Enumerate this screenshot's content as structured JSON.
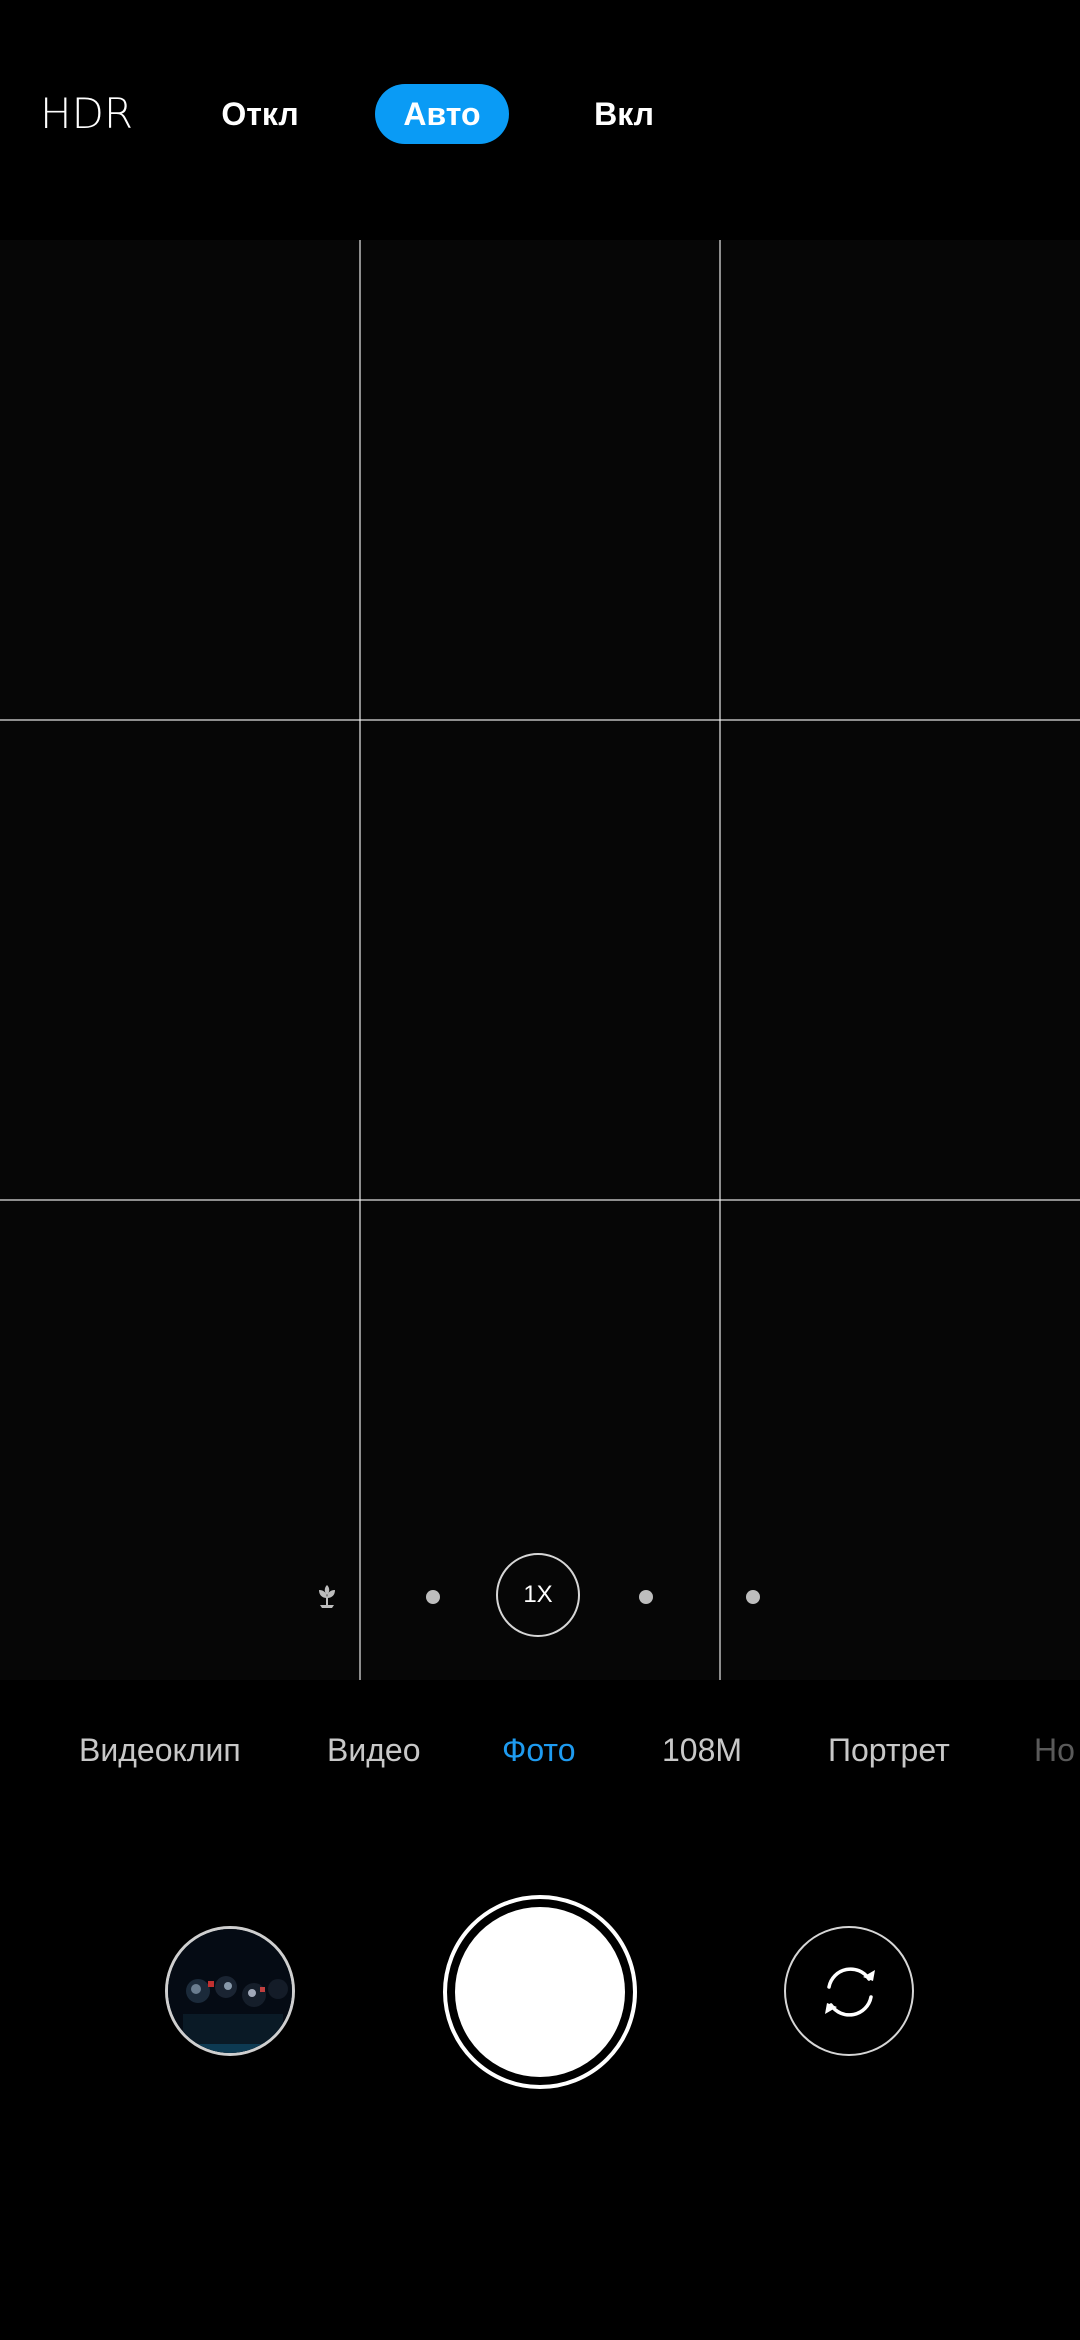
{
  "hdr": {
    "title": "HDR",
    "options": {
      "off": "Откл",
      "auto": "Авто",
      "on": "Вкл"
    },
    "selected": "auto",
    "accent_color": "#0a9bf5"
  },
  "viewfinder": {
    "grid": "3x3",
    "zoom": {
      "current": "1X",
      "icons": [
        "macro-flower-icon"
      ]
    }
  },
  "modes": {
    "items": [
      "Видеоклип",
      "Видео",
      "Фото",
      "108M",
      "Портрет",
      "Но"
    ],
    "selected": "Фото",
    "selected_color": "#1e9bf0"
  },
  "controls": {
    "gallery_icon": "gallery-thumbnail",
    "shutter_icon": "shutter-button",
    "switch_icon": "switch-camera-icon"
  }
}
